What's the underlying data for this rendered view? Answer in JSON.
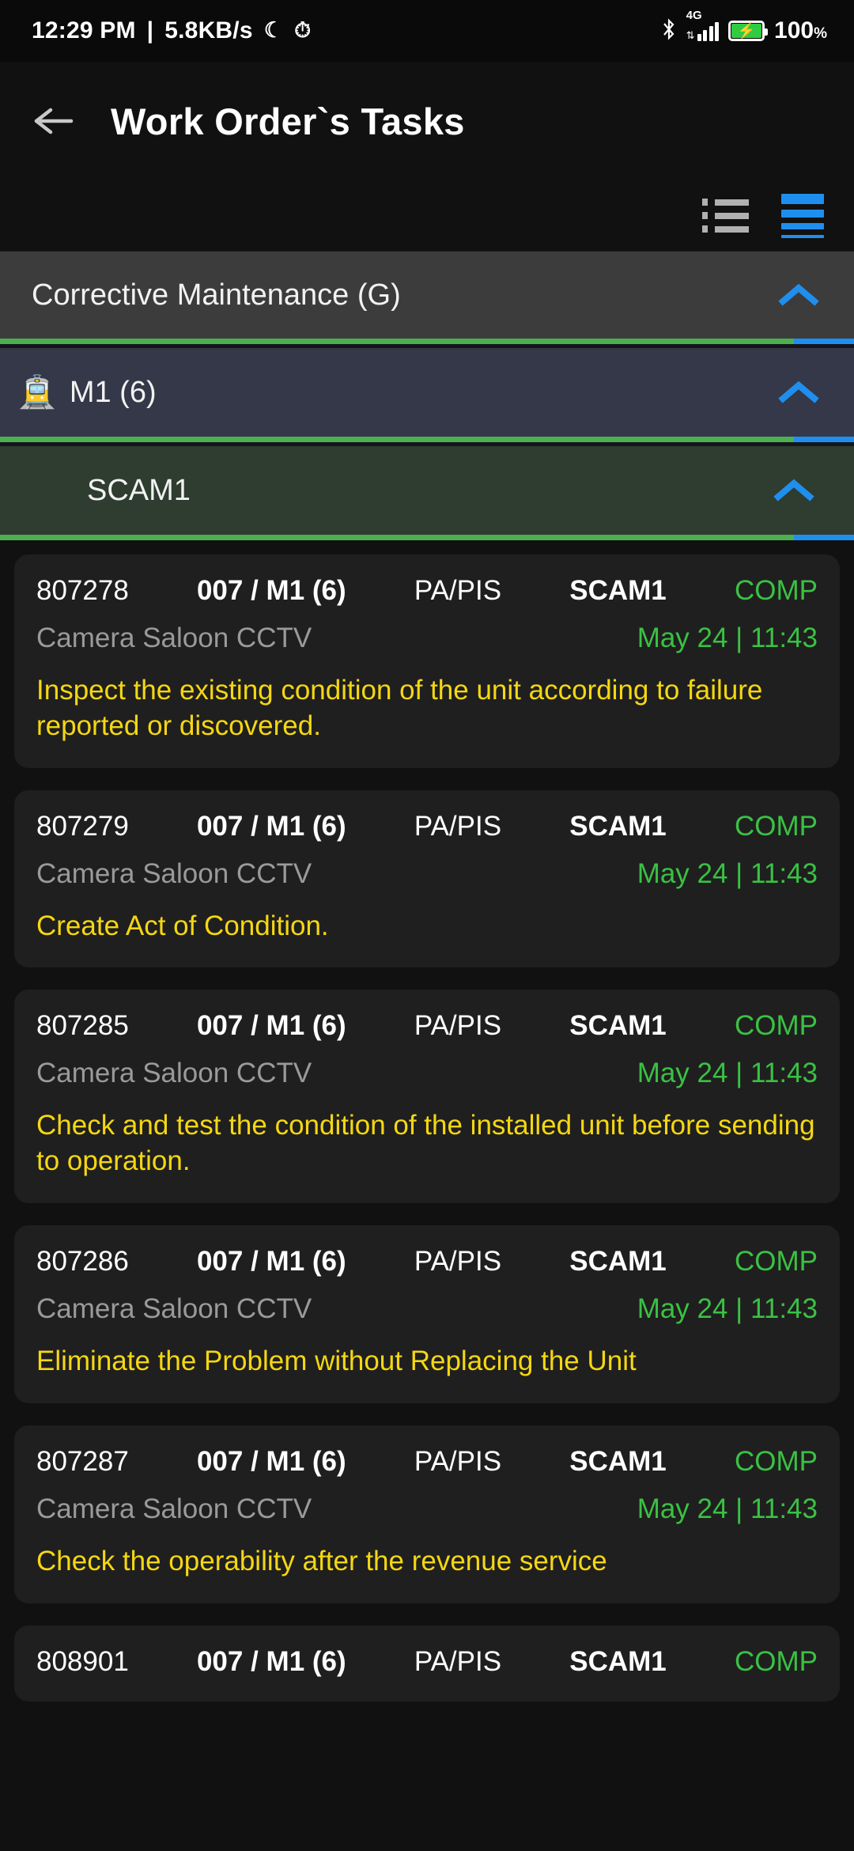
{
  "status_bar": {
    "time": "12:29 PM",
    "separator": "|",
    "network_speed": "5.8KB/s",
    "moon_icon": "moon-icon",
    "alarm_icon": "alarm-icon",
    "bluetooth_icon": "bluetooth-icon",
    "network_type": "4G",
    "battery_percent": "100",
    "battery_percent_symbol": "%"
  },
  "app_bar": {
    "back_label": "back-arrow",
    "title": "Work Order`s Tasks"
  },
  "toolbar": {
    "list_view_label": "list-view",
    "dense_view_label": "dense-view",
    "active_view": "dense-view",
    "accent_blue": "#1f8fef",
    "inactive_gray": "#b0b0b0"
  },
  "groups": {
    "level1": {
      "label": "Corrective Maintenance (G)",
      "expanded": true,
      "chevron": "chevron-up-icon",
      "progress_green_percent": 93
    },
    "level2": {
      "icon": "tram-icon",
      "label": "M1 (6)",
      "expanded": true,
      "chevron": "chevron-up-icon",
      "progress_green_percent": 93
    },
    "level3": {
      "label": "SCAM1",
      "expanded": true,
      "chevron": "chevron-up-icon",
      "progress_green_percent": 93
    }
  },
  "colors": {
    "status_complete": "#3ac144",
    "description": "#f5d712",
    "subtitle": "#9a9a9a",
    "progress_green": "#4caf50",
    "progress_blue": "#1f8fef"
  },
  "tasks": [
    {
      "id": "807278",
      "unit": "007 / M1 (6)",
      "system": "PA/PIS",
      "code": "SCAM1",
      "status": "COMP",
      "equipment": "Camera Saloon CCTV",
      "date": "May 24 | 11:43",
      "description": "Inspect the existing condition of the unit according to failure reported or discovered."
    },
    {
      "id": "807279",
      "unit": "007 / M1 (6)",
      "system": "PA/PIS",
      "code": "SCAM1",
      "status": "COMP",
      "equipment": "Camera Saloon CCTV",
      "date": "May 24 | 11:43",
      "description": "Create Act of Condition."
    },
    {
      "id": "807285",
      "unit": "007 / M1 (6)",
      "system": "PA/PIS",
      "code": "SCAM1",
      "status": "COMP",
      "equipment": "Camera Saloon CCTV",
      "date": "May 24 | 11:43",
      "description": "Check and test the condition of the installed unit before sending to operation."
    },
    {
      "id": "807286",
      "unit": "007 / M1 (6)",
      "system": "PA/PIS",
      "code": "SCAM1",
      "status": "COMP",
      "equipment": "Camera Saloon CCTV",
      "date": "May 24 | 11:43",
      "description": "Eliminate the Problem without Replacing the Unit"
    },
    {
      "id": "807287",
      "unit": "007 / M1 (6)",
      "system": "PA/PIS",
      "code": "SCAM1",
      "status": "COMP",
      "equipment": "Camera Saloon CCTV",
      "date": "May 24 | 11:43",
      "description": "Check the operability after the revenue service"
    },
    {
      "id": "808901",
      "unit": "007 / M1 (6)",
      "system": "PA/PIS",
      "code": "SCAM1",
      "status": "COMP",
      "equipment": "",
      "date": "",
      "description": ""
    }
  ]
}
